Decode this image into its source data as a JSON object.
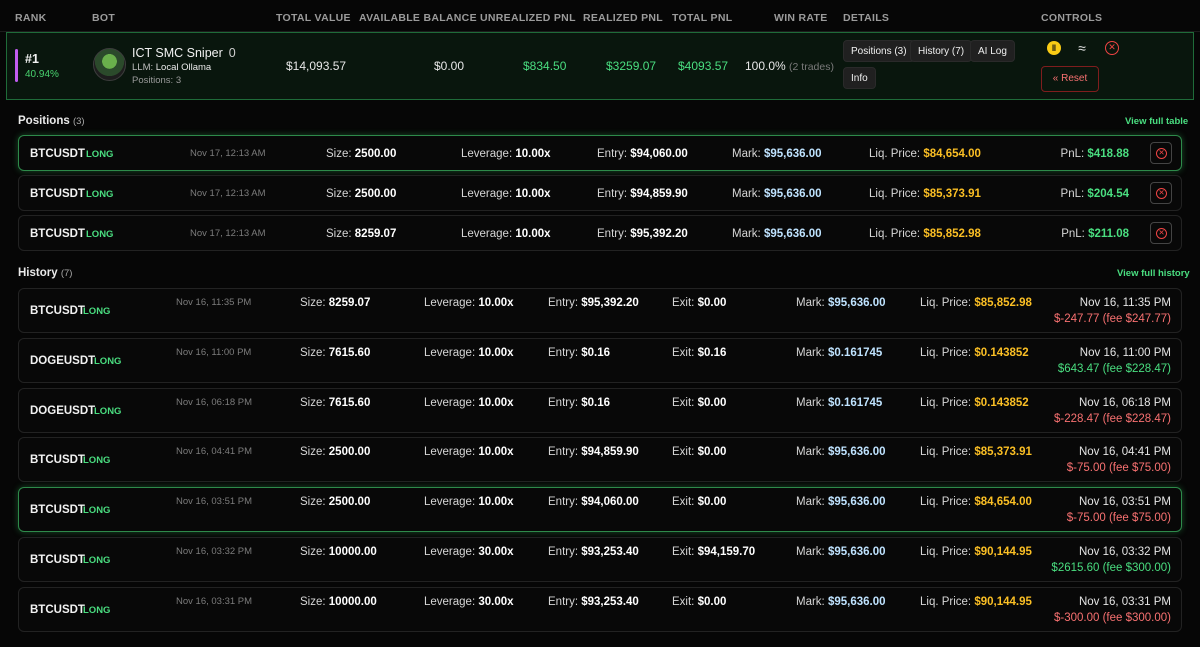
{
  "header": {
    "rank": "RANK",
    "bot": "BOT",
    "total_value": "TOTAL VALUE",
    "available_balance": "AVAILABLE BALANCE",
    "unrealized_pnl": "UNREALIZED PNL",
    "realized_pnl": "REALIZED PNL",
    "total_pnl": "TOTAL PNL",
    "win_rate": "WIN RATE",
    "details": "DETAILS",
    "controls": "CONTROLS"
  },
  "bot": {
    "rank": "#1",
    "rank_pct": "40.94%",
    "name": "ICT SMC Sniper",
    "name_count": "0",
    "llm_label": "LLM:",
    "llm_value": "Local Ollama",
    "positions_label": "Positions: 3",
    "total_value": "$14,093.57",
    "available_balance": "$0.00",
    "unrealized_pnl": "$834.50",
    "realized_pnl": "$3259.07",
    "total_pnl": "$4093.57",
    "win_rate": "100.0%",
    "trades": "(2 trades)",
    "details_buttons": {
      "positions": "Positions (3)",
      "history": "History (7)",
      "ai_log": "AI Log",
      "info": "Info"
    },
    "controls": {
      "reset": "Reset"
    },
    "colors": {
      "accent": "#4ade80",
      "rank_bar": "#c15cf0",
      "danger": "#ef4444",
      "pause": "#facc15"
    }
  },
  "positions": {
    "title": "Positions",
    "count": "(3)",
    "view_link": "View full table",
    "labels": {
      "size": "Size:",
      "leverage": "Leverage:",
      "entry": "Entry:",
      "mark": "Mark:",
      "liq": "Liq. Price:",
      "pnl": "PnL:"
    },
    "items": [
      {
        "symbol": "BTCUSDT",
        "side": "LONG",
        "time": "Nov 17, 12:13 AM",
        "size": "2500.00",
        "leverage": "10.00x",
        "entry": "$94,060.00",
        "mark": "$95,636.00",
        "liq": "$84,654.00",
        "pnl": "$418.88"
      },
      {
        "symbol": "BTCUSDT",
        "side": "LONG",
        "time": "Nov 17, 12:13 AM",
        "size": "2500.00",
        "leverage": "10.00x",
        "entry": "$94,859.90",
        "mark": "$95,636.00",
        "liq": "$85,373.91",
        "pnl": "$204.54"
      },
      {
        "symbol": "BTCUSDT",
        "side": "LONG",
        "time": "Nov 17, 12:13 AM",
        "size": "8259.07",
        "leverage": "10.00x",
        "entry": "$95,392.20",
        "mark": "$95,636.00",
        "liq": "$85,852.98",
        "pnl": "$211.08"
      }
    ]
  },
  "history": {
    "title": "History",
    "count": "(7)",
    "view_link": "View full history",
    "labels": {
      "size": "Size:",
      "leverage": "Leverage:",
      "entry": "Entry:",
      "exit": "Exit:",
      "mark": "Mark:",
      "liq": "Liq. Price:"
    },
    "items": [
      {
        "symbol": "BTCUSDT",
        "side": "LONG",
        "time": "Nov 16, 11:35 PM",
        "size": "8259.07",
        "leverage": "10.00x",
        "entry": "$95,392.20",
        "exit": "$0.00",
        "mark": "$95,636.00",
        "liq": "$85,852.98",
        "closed": "Nov 16, 11:35 PM",
        "pnl": "$-247.77 (fee $247.77)",
        "pnl_positive": false
      },
      {
        "symbol": "DOGEUSDT",
        "side": "LONG",
        "time": "Nov 16, 11:00 PM",
        "size": "7615.60",
        "leverage": "10.00x",
        "entry": "$0.16",
        "exit": "$0.16",
        "mark": "$0.161745",
        "liq": "$0.143852",
        "closed": "Nov 16, 11:00 PM",
        "pnl": "$643.47 (fee $228.47)",
        "pnl_positive": true
      },
      {
        "symbol": "DOGEUSDT",
        "side": "LONG",
        "time": "Nov 16, 06:18 PM",
        "size": "7615.60",
        "leverage": "10.00x",
        "entry": "$0.16",
        "exit": "$0.00",
        "mark": "$0.161745",
        "liq": "$0.143852",
        "closed": "Nov 16, 06:18 PM",
        "pnl": "$-228.47 (fee $228.47)",
        "pnl_positive": false
      },
      {
        "symbol": "BTCUSDT",
        "side": "LONG",
        "time": "Nov 16, 04:41 PM",
        "size": "2500.00",
        "leverage": "10.00x",
        "entry": "$94,859.90",
        "exit": "$0.00",
        "mark": "$95,636.00",
        "liq": "$85,373.91",
        "closed": "Nov 16, 04:41 PM",
        "pnl": "$-75.00 (fee $75.00)",
        "pnl_positive": false
      },
      {
        "symbol": "BTCUSDT",
        "side": "LONG",
        "time": "Nov 16, 03:51 PM",
        "size": "2500.00",
        "leverage": "10.00x",
        "entry": "$94,060.00",
        "exit": "$0.00",
        "mark": "$95,636.00",
        "liq": "$84,654.00",
        "closed": "Nov 16, 03:51 PM",
        "pnl": "$-75.00 (fee $75.00)",
        "pnl_positive": false
      },
      {
        "symbol": "BTCUSDT",
        "side": "LONG",
        "time": "Nov 16, 03:32 PM",
        "size": "10000.00",
        "leverage": "30.00x",
        "entry": "$93,253.40",
        "exit": "$94,159.70",
        "mark": "$95,636.00",
        "liq": "$90,144.95",
        "closed": "Nov 16, 03:32 PM",
        "pnl": "$2615.60 (fee $300.00)",
        "pnl_positive": true
      },
      {
        "symbol": "BTCUSDT",
        "side": "LONG",
        "time": "Nov 16, 03:31 PM",
        "size": "10000.00",
        "leverage": "30.00x",
        "entry": "$93,253.40",
        "exit": "$0.00",
        "mark": "$95,636.00",
        "liq": "$90,144.95",
        "closed": "Nov 16, 03:31 PM",
        "pnl": "$-300.00 (fee $300.00)",
        "pnl_positive": false
      }
    ]
  }
}
